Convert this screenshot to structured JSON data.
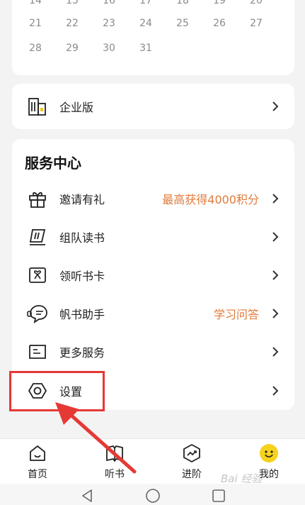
{
  "calendar": {
    "partial_row": [
      "14",
      "15",
      "16",
      "17",
      "18",
      "19",
      "20"
    ],
    "rows": [
      [
        "21",
        "22",
        "23",
        "24",
        "25",
        "26",
        "27"
      ],
      [
        "28",
        "29",
        "30",
        "31"
      ]
    ]
  },
  "enterprise": {
    "label": "企业版"
  },
  "service_center": {
    "title": "服务中心",
    "items": [
      {
        "label": "邀请有礼",
        "extra": "最高获得4000积分",
        "icon": "gift-icon"
      },
      {
        "label": "组队读书",
        "extra": "",
        "icon": "flag-icon"
      },
      {
        "label": "领听书卡",
        "extra": "",
        "icon": "card-icon"
      },
      {
        "label": "帆书助手",
        "extra": "学习问答",
        "icon": "assistant-icon"
      },
      {
        "label": "更多服务",
        "extra": "",
        "icon": "more-services-icon"
      },
      {
        "label": "设置",
        "extra": "",
        "icon": "settings-icon"
      }
    ]
  },
  "bottom_nav": {
    "items": [
      {
        "label": "首页",
        "icon": "home-icon"
      },
      {
        "label": "听书",
        "icon": "book-icon"
      },
      {
        "label": "进阶",
        "icon": "progress-icon"
      },
      {
        "label": "我的",
        "icon": "smiley-icon"
      }
    ]
  },
  "colors": {
    "accent_orange": "#e07a3b",
    "highlight_red": "#e53935",
    "avatar_yellow": "#f6d21d"
  },
  "watermark": "Bai 经验"
}
